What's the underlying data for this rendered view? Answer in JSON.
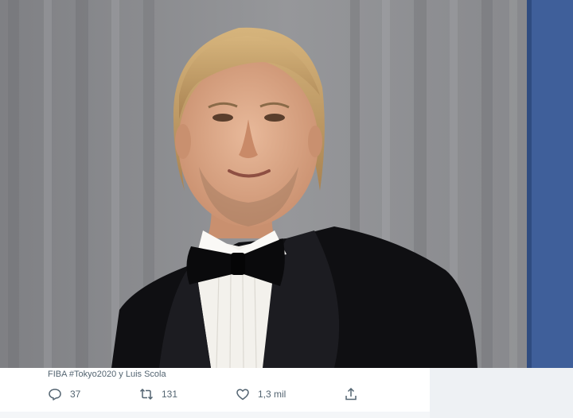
{
  "photo": {
    "subject": "man-in-tuxedo-with-bow-tie",
    "background_color": "#8e8f92",
    "side_panel_color": "#3f5f9a"
  },
  "tweet": {
    "caption": "FIBA #Tokyo2020 y Luis Scola",
    "actions": {
      "reply": {
        "icon": "reply-icon",
        "count": "37"
      },
      "retweet": {
        "icon": "retweet-icon",
        "count": "131"
      },
      "like": {
        "icon": "heart-icon",
        "count": "1,3 mil"
      },
      "share": {
        "icon": "share-icon"
      }
    }
  },
  "colors": {
    "muted_text": "#536471"
  }
}
